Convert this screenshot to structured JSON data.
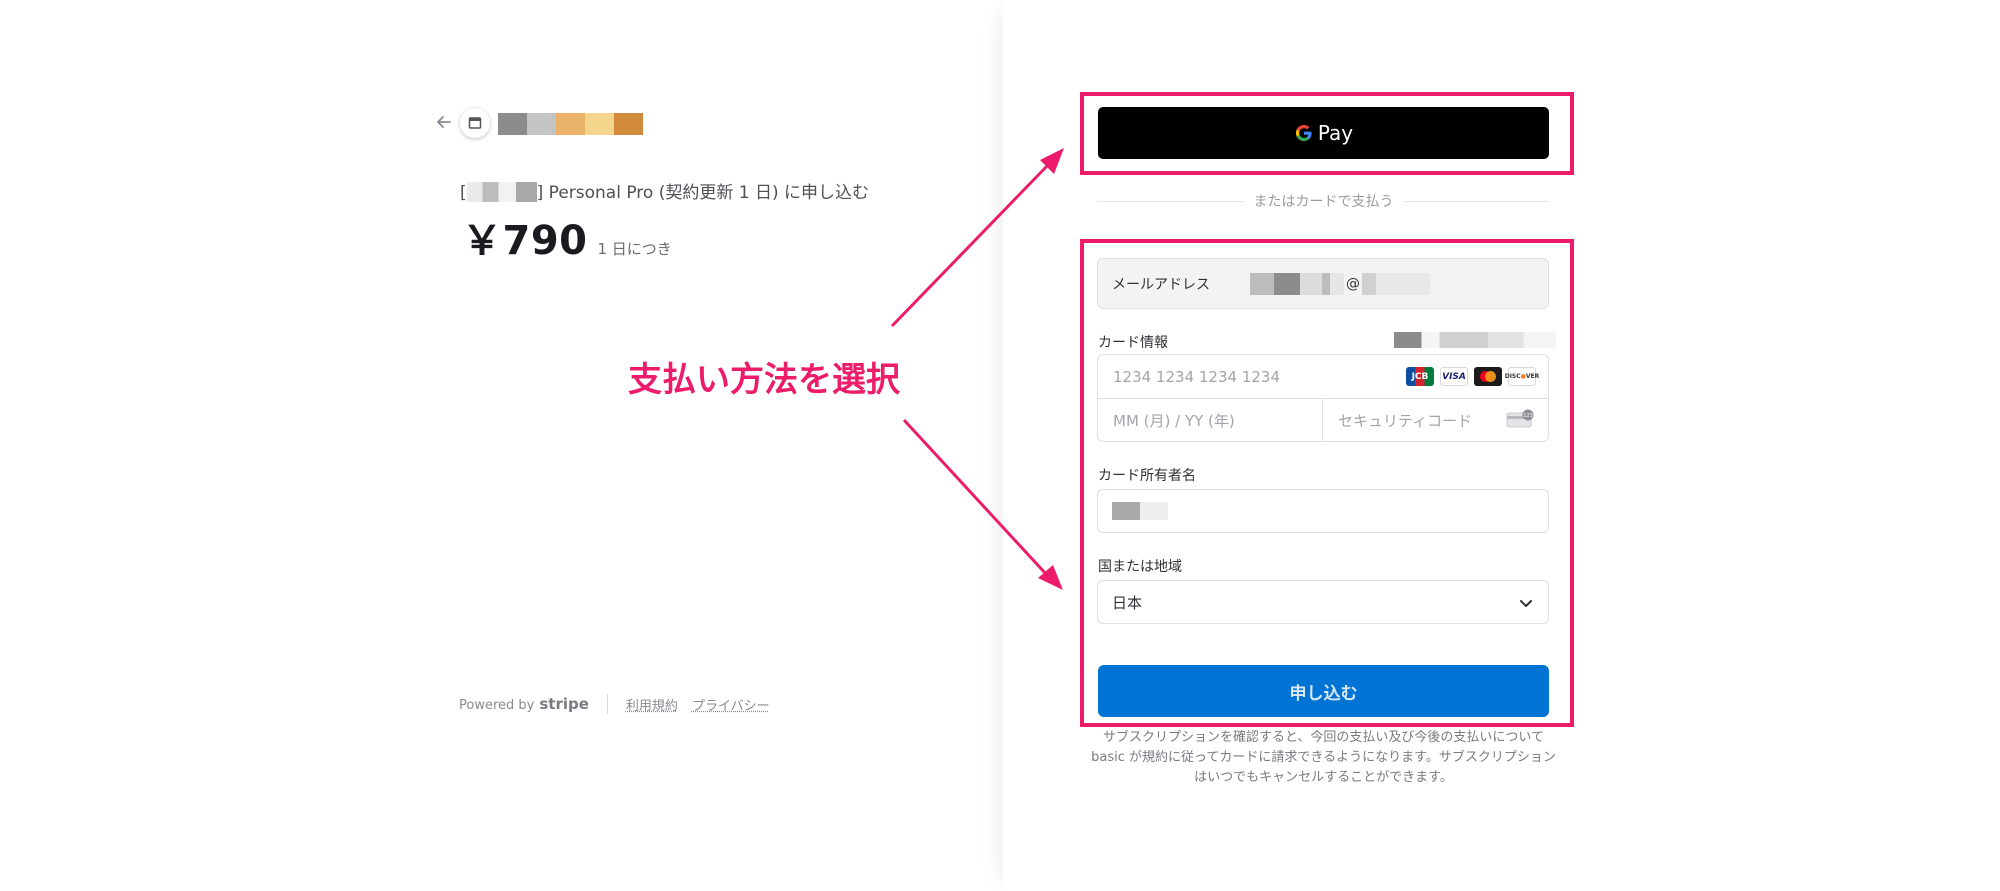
{
  "merchant": {
    "name_redaction_colors": [
      "#8c8c8c",
      "#c4c4c4",
      "#ebb36a",
      "#f5d48c",
      "#d08a3a"
    ]
  },
  "product": {
    "title_open": "[",
    "title_rest": "] Personal Pro (契約更新 1 日) に申し込む",
    "price": "￥790",
    "period": "1 日につき"
  },
  "footer": {
    "powered_by": "Powered by",
    "stripe": "stripe",
    "terms_link": "利用規約",
    "privacy_link": "プライバシー"
  },
  "annotation": {
    "label": "支払い方法を選択",
    "color": "#ec1c6b"
  },
  "wallet": {
    "gpay_label": "Pay"
  },
  "divider_text": "またはカードで支払う",
  "form": {
    "email_label": "メールアドレス",
    "email_at": "@",
    "card_label": "カード情報",
    "card_number_placeholder": "1234 1234 1234 1234",
    "expiry_placeholder": "MM (月) / YY (年)",
    "cvc_placeholder": "セキュリティコード",
    "card_brands": [
      "JCB",
      "VISA",
      "Mastercard",
      "Discover"
    ],
    "cardholder_label": "カード所有者名",
    "country_label": "国または地域",
    "country_value": "日本",
    "submit_label": "申し込む"
  },
  "terms_text": "サブスクリプションを確認すると、今回の支払い及び今後の支払いについて basic が規約に従ってカードに請求できるようになります。サブスクリプションはいつでもキャンセルすることができます。"
}
